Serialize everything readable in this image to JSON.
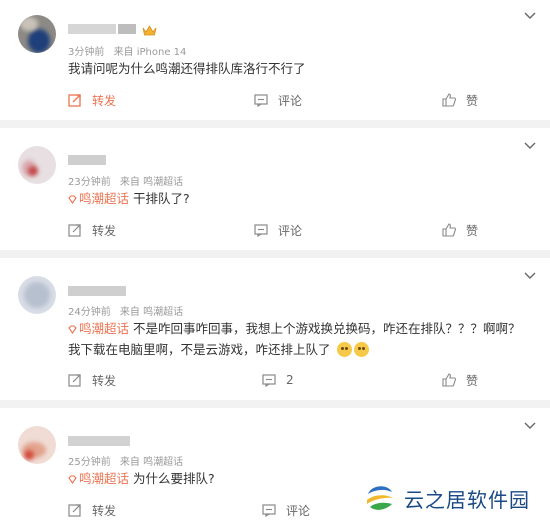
{
  "accent_color": "#eb7350",
  "tag_label": "鸣潮超话",
  "comments": [
    {
      "meta": {
        "time": "3分钟前",
        "source": "来自 iPhone 14"
      },
      "text": "我请问呢为什么鸣潮还得排队库洛行不行了",
      "has_tag": false,
      "actions": {
        "share": "转发",
        "comment": "评论",
        "like": "赞"
      }
    },
    {
      "meta": {
        "time": "23分钟前",
        "source": "来自 鸣潮超话"
      },
      "text": "干排队了?",
      "has_tag": true,
      "actions": {
        "share": "转发",
        "comment": "评论",
        "like": "赞"
      }
    },
    {
      "meta": {
        "time": "24分钟前",
        "source": "来自 鸣潮超话"
      },
      "text": "不是咋回事咋回事，我想上个游戏换兑换码，咋还在排队？？？啊啊？我下载在电脑里啊，不是云游戏，咋还排上队了",
      "has_tag": true,
      "actions": {
        "share": "转发",
        "comment": "2",
        "like": "赞"
      }
    },
    {
      "meta": {
        "time": "25分钟前",
        "source": "来自 鸣潮超话"
      },
      "text": "为什么要排队?",
      "has_tag": true,
      "actions": {
        "share": "转发",
        "comment": "评论",
        "like": "赞"
      }
    }
  ],
  "watermark": "云之居软件园",
  "icons": [
    "chevron-down-icon",
    "share-icon",
    "comment-icon",
    "like-icon",
    "super-topic-icon",
    "crown-badge-icon",
    "smiley-emoji-icon"
  ]
}
